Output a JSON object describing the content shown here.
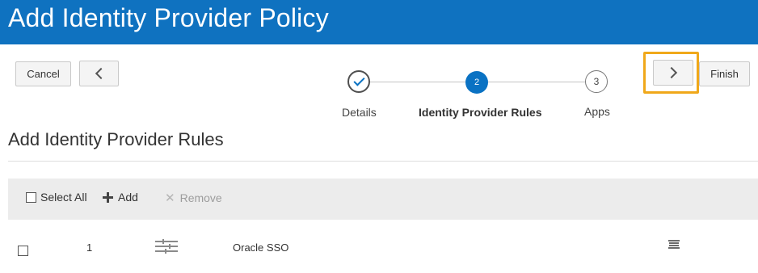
{
  "header": {
    "title": "Add Identity Provider Policy"
  },
  "nav": {
    "cancel_label": "Cancel",
    "finish_label": "Finish",
    "prev_icon": "chevron-left-icon",
    "next_icon": "chevron-right-icon"
  },
  "train": {
    "steps": [
      {
        "number": "1",
        "label": "Details",
        "state": "completed"
      },
      {
        "number": "2",
        "label": "Identity Provider Rules",
        "state": "current"
      },
      {
        "number": "3",
        "label": "Apps",
        "state": "pending"
      }
    ]
  },
  "section": {
    "title": "Add Identity Provider Rules"
  },
  "toolbar": {
    "select_all_label": "Select All",
    "add_label": "Add",
    "remove_label": "Remove"
  },
  "rules": {
    "rows": [
      {
        "index": "1",
        "name": "Oracle SSO"
      }
    ]
  },
  "colors": {
    "header_bg": "#0f72c0",
    "accent": "#0a72c3",
    "highlight": "#f0a81a"
  }
}
